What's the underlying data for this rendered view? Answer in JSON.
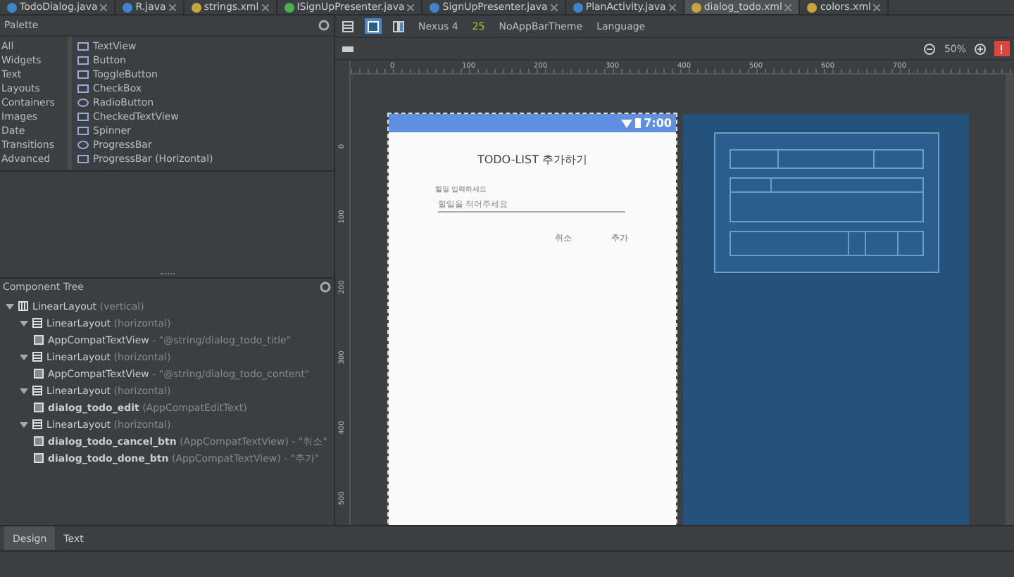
{
  "editor_tabs": [
    {
      "label": "TodoDialog.java",
      "kind": "class",
      "selected": false
    },
    {
      "label": "R.java",
      "kind": "class",
      "selected": false
    },
    {
      "label": "strings.xml",
      "kind": "xml",
      "selected": false
    },
    {
      "label": "ISignUpPresenter.java",
      "kind": "interface",
      "selected": false
    },
    {
      "label": "SignUpPresenter.java",
      "kind": "class",
      "selected": false
    },
    {
      "label": "PlanActivity.java",
      "kind": "class",
      "selected": false
    },
    {
      "label": "dialog_todo.xml",
      "kind": "xml",
      "selected": true
    },
    {
      "label": "colors.xml",
      "kind": "xml",
      "selected": false
    }
  ],
  "palette": {
    "title": "Palette",
    "categories": [
      "All",
      "Widgets",
      "Text",
      "Layouts",
      "Containers",
      "Images",
      "Date",
      "Transitions",
      "Advanced"
    ],
    "widgets": [
      {
        "label": "TextView",
        "kind": "text"
      },
      {
        "label": "Button",
        "kind": "button"
      },
      {
        "label": "ToggleButton",
        "kind": "toggle"
      },
      {
        "label": "CheckBox",
        "kind": "check"
      },
      {
        "label": "RadioButton",
        "kind": "radio"
      },
      {
        "label": "CheckedTextView",
        "kind": "checked"
      },
      {
        "label": "Spinner",
        "kind": "spinner"
      },
      {
        "label": "ProgressBar",
        "kind": "progress"
      },
      {
        "label": "ProgressBar (Horizontal)",
        "kind": "hbar"
      }
    ]
  },
  "toolbar": {
    "device": "Nexus 4",
    "api": "25",
    "theme": "NoAppBarTheme",
    "language": "Language",
    "zoom": "50%"
  },
  "rulers": {
    "horizontal": [
      "0",
      "100",
      "200",
      "300",
      "400",
      "500",
      "600",
      "700"
    ],
    "vertical": [
      "0",
      "100",
      "200",
      "300",
      "400",
      "500"
    ]
  },
  "preview": {
    "time": "7:00",
    "title": "TODO-LIST 추가하기",
    "label": "할일 입력하세요",
    "placeholder": "할일을 적어주세요",
    "buttons": [
      "취소",
      "추가"
    ]
  },
  "component_tree": {
    "title": "Component Tree",
    "items": [
      {
        "name": "LinearLayout",
        "detail": "(vertical)",
        "kind": "vertical",
        "expanded": true,
        "bold": false,
        "children": [
          {
            "name": "LinearLayout",
            "detail": "(horizontal)",
            "kind": "horizontal",
            "expanded": true,
            "bold": false,
            "children": [
              {
                "name": "AppCompatTextView",
                "detail": "- \"@string/dialog_todo_title\"",
                "kind": "view",
                "bold": false
              }
            ]
          },
          {
            "name": "LinearLayout",
            "detail": "(horizontal)",
            "kind": "horizontal",
            "expanded": true,
            "bold": false,
            "children": [
              {
                "name": "AppCompatTextView",
                "detail": "- \"@string/dialog_todo_content\"",
                "kind": "view",
                "bold": false
              }
            ]
          },
          {
            "name": "LinearLayout",
            "detail": "(horizontal)",
            "kind": "horizontal",
            "expanded": true,
            "bold": false,
            "children": [
              {
                "name": "dialog_todo_edit",
                "detail": "(AppCompatEditText)",
                "kind": "view",
                "bold": true
              }
            ]
          },
          {
            "name": "LinearLayout",
            "detail": "(horizontal)",
            "kind": "horizontal",
            "expanded": true,
            "bold": false,
            "children": [
              {
                "name": "dialog_todo_cancel_btn",
                "detail": "(AppCompatTextView) - \"취소\"",
                "kind": "view",
                "bold": true
              },
              {
                "name": "dialog_todo_done_btn",
                "detail": "(AppCompatTextView) - \"추가\"",
                "kind": "view",
                "bold": true
              }
            ]
          }
        ]
      }
    ]
  },
  "bottom_tabs": [
    {
      "label": "Design",
      "selected": true
    },
    {
      "label": "Text",
      "selected": false
    }
  ]
}
